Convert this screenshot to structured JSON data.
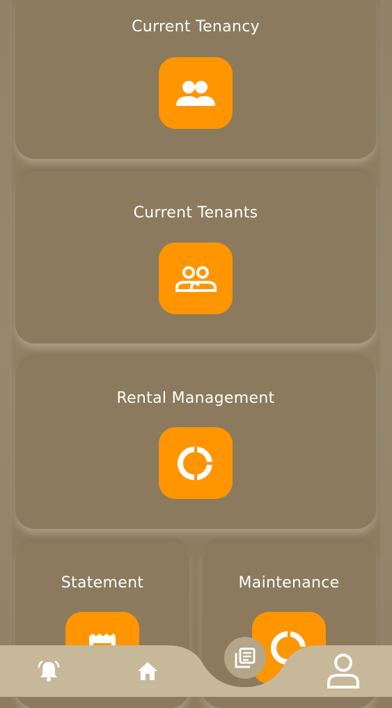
{
  "cards": {
    "current_tenancy": {
      "title": "Current Tenancy",
      "icon": "group-icon"
    },
    "current_tenants": {
      "title": "Current Tenants",
      "icon": "group-outline-icon"
    },
    "rental_management": {
      "title": "Rental Management",
      "icon": "donut-chart-icon"
    },
    "statement": {
      "title": "Statement",
      "icon": "receipt-icon"
    },
    "maintenance": {
      "title": "Maintenance",
      "icon": "donut-chart-icon"
    }
  },
  "bottom_nav": {
    "items": [
      {
        "icon": "notification-bell-icon"
      },
      {
        "icon": "home-icon"
      },
      {
        "icon": "articles-icon"
      },
      {
        "icon": "profile-icon"
      }
    ]
  },
  "colors": {
    "accent": "#ff9500",
    "card": "#8b7a5d",
    "nav": "#c7b89a",
    "text": "#ffffff"
  }
}
